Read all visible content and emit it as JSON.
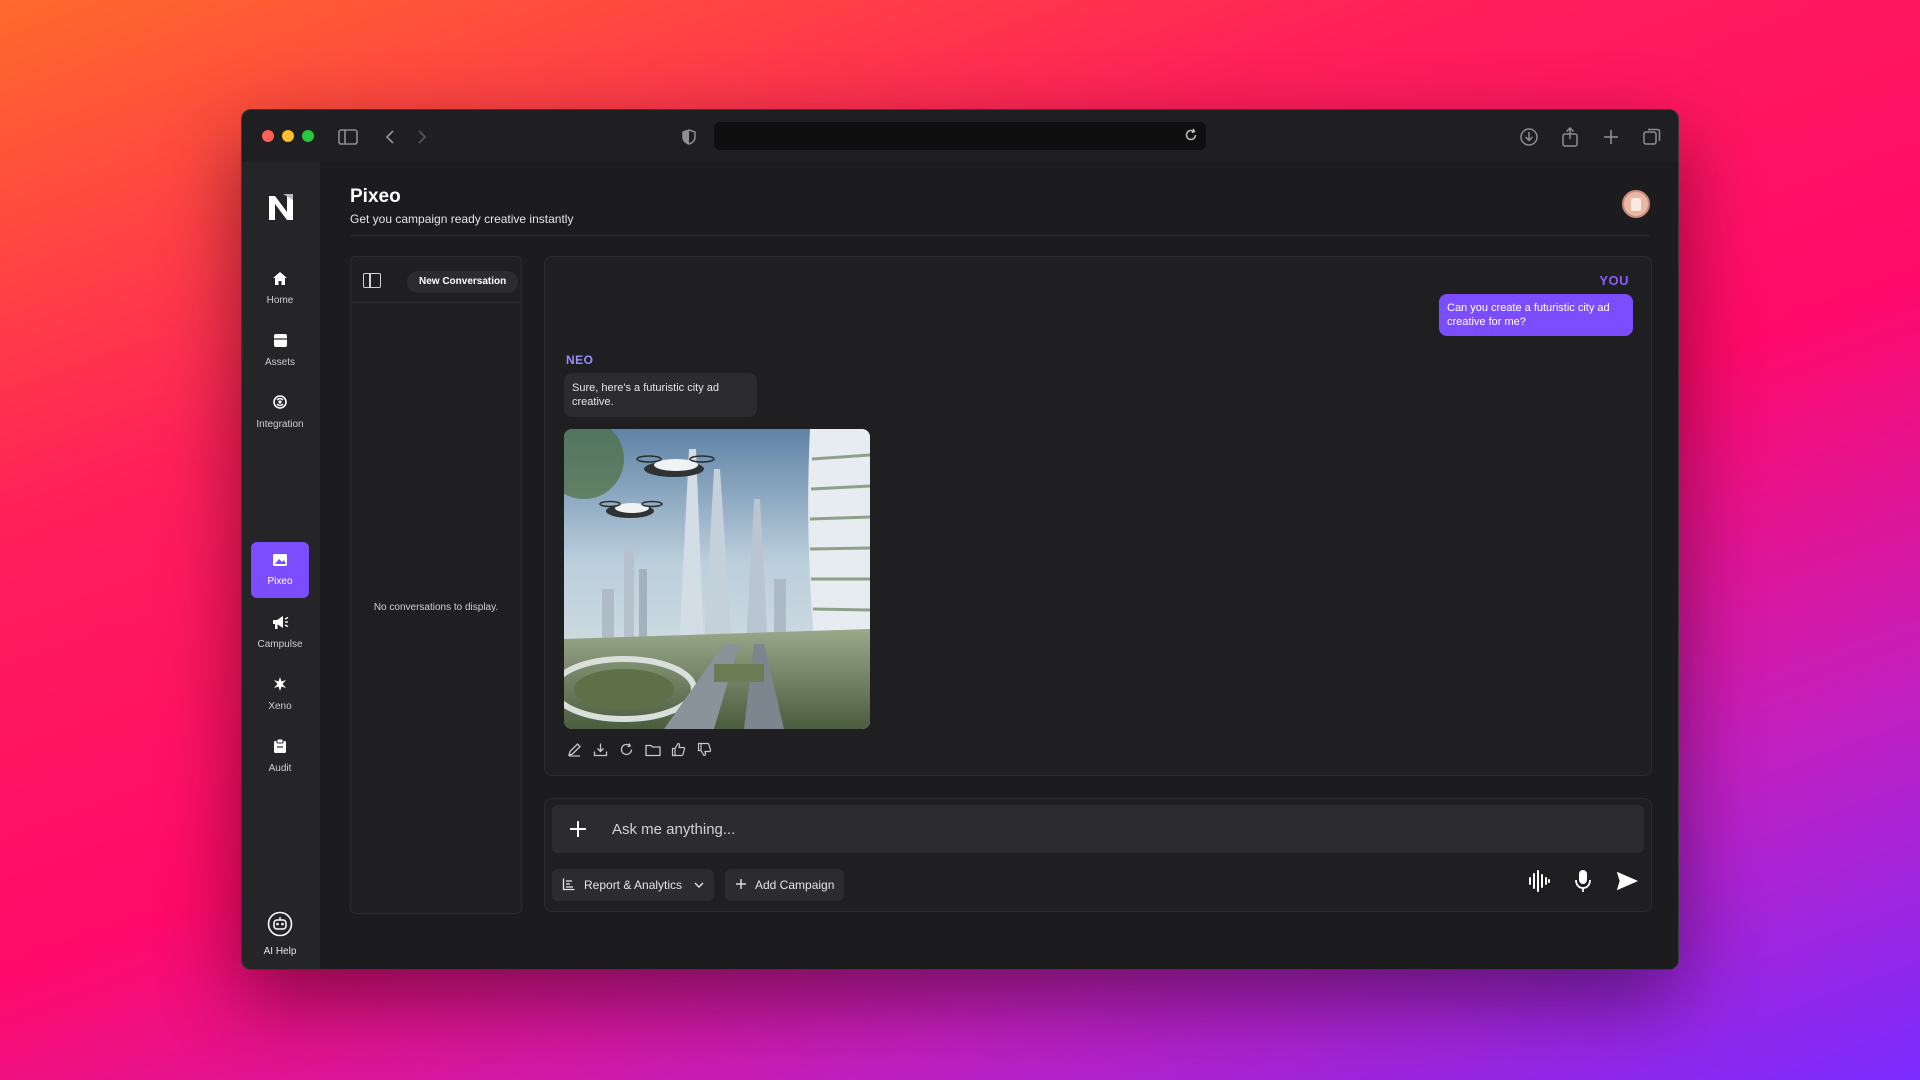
{
  "browser": {
    "traffic_colors": [
      "#ff5f57",
      "#febc2e",
      "#28c840"
    ],
    "url": ""
  },
  "sidebar": {
    "items": [
      {
        "label": "Home",
        "icon": "home-icon"
      },
      {
        "label": "Assets",
        "icon": "assets-icon"
      },
      {
        "label": "Integration",
        "icon": "integration-icon"
      },
      {
        "label": "Pixeo",
        "icon": "image-icon",
        "active": true
      },
      {
        "label": "Campulse",
        "icon": "megaphone-icon"
      },
      {
        "label": "Xeno",
        "icon": "xeno-icon"
      },
      {
        "label": "Audit",
        "icon": "audit-icon"
      }
    ],
    "help_label": "AI Help",
    "accent": "#7c4dff"
  },
  "header": {
    "title": "Pixeo",
    "subtitle": "Get you campaign ready creative instantly"
  },
  "conversations": {
    "new_button": "New Conversation",
    "empty_text": "No conversations to display."
  },
  "chat": {
    "you_label": "YOU",
    "you_message": "Can you create a futuristic city ad creative for me?",
    "neo_label": "NEO",
    "neo_message": "Sure, here's a futuristic city ad creative."
  },
  "composer": {
    "placeholder": "Ask me anything...",
    "report_label": "Report & Analytics",
    "campaign_label": "Add Campaign"
  }
}
